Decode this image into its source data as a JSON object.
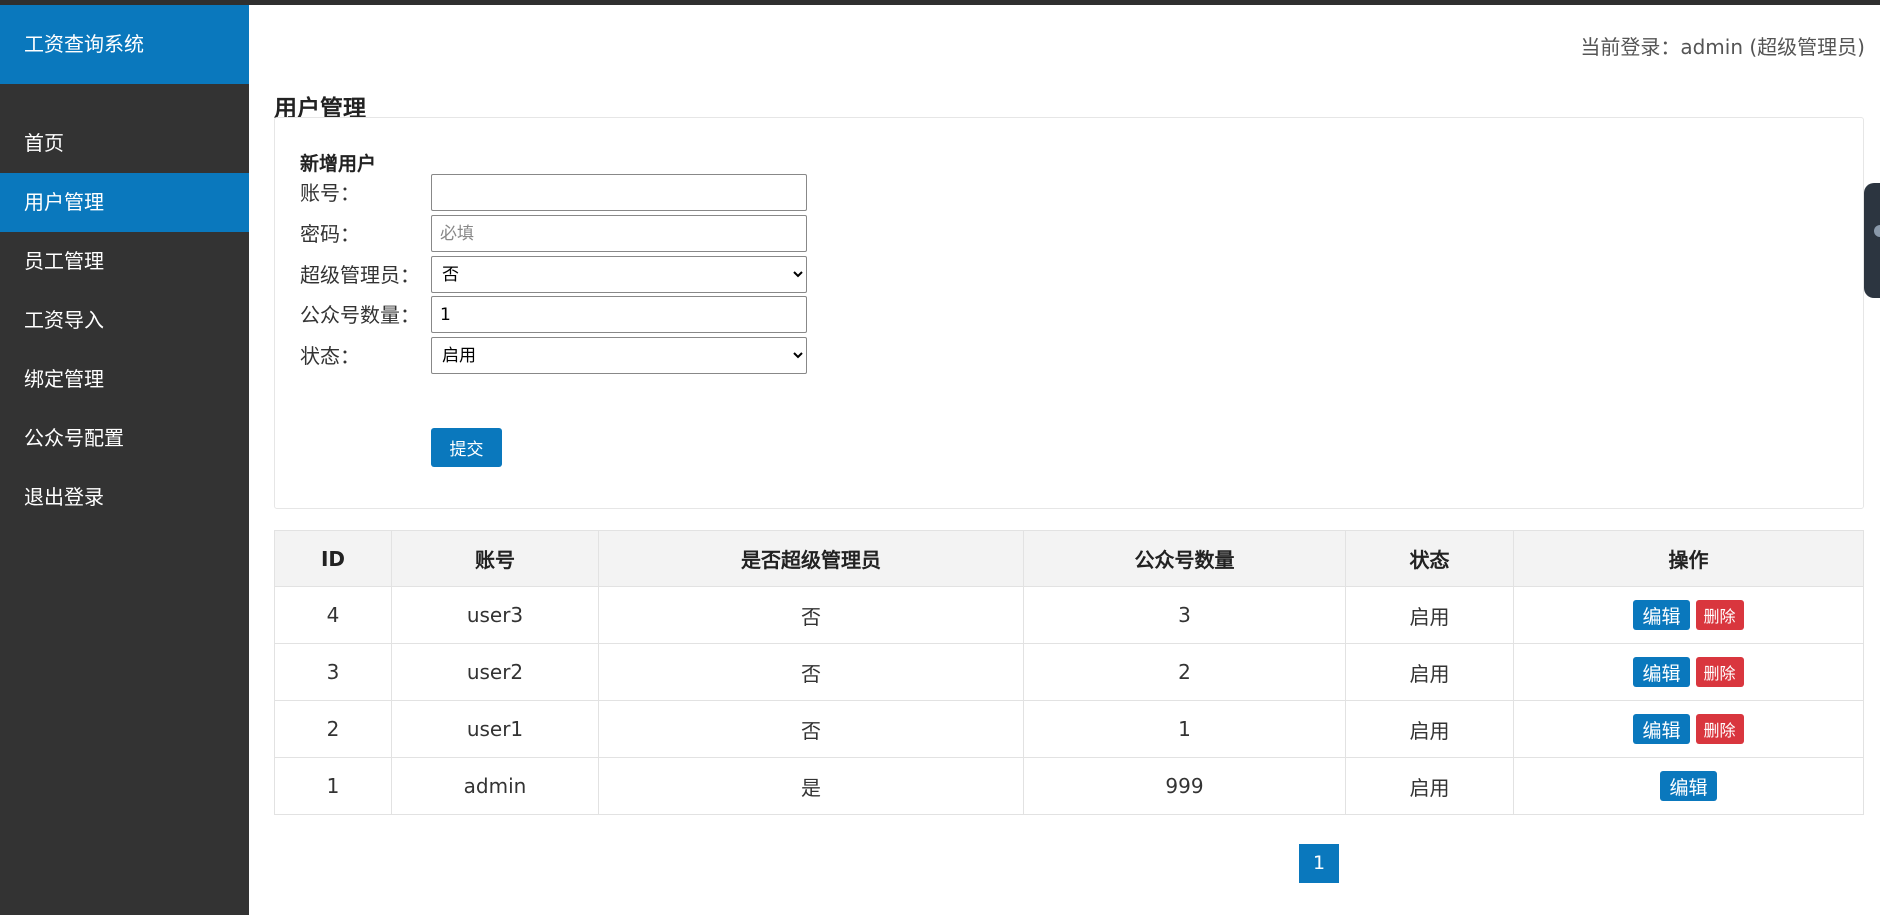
{
  "app": {
    "title": "工资查询系统"
  },
  "sidebar": {
    "items": [
      {
        "label": "首页"
      },
      {
        "label": "用户管理"
      },
      {
        "label": "员工管理"
      },
      {
        "label": "工资导入"
      },
      {
        "label": "绑定管理"
      },
      {
        "label": "公众号配置"
      },
      {
        "label": "退出登录"
      }
    ],
    "active": "用户管理"
  },
  "header": {
    "current_user": "当前登录：admin (超级管理员)"
  },
  "page": {
    "title": "用户管理"
  },
  "form": {
    "title": "新增用户",
    "account_label": "账号：",
    "account_value": "",
    "password_label": "密码：",
    "password_placeholder": "必填",
    "superadmin_label": "超级管理员：",
    "superadmin_value": "否",
    "count_label": "公众号数量：",
    "count_value": "1",
    "status_label": "状态：",
    "status_value": "启用",
    "submit_label": "提交"
  },
  "table": {
    "headers": [
      "ID",
      "账号",
      "是否超级管理员",
      "公众号数量",
      "状态",
      "操作"
    ],
    "rows": [
      {
        "id": "4",
        "account": "user3",
        "is_super": "否",
        "count": "3",
        "status": "启用",
        "edit": "编辑",
        "delete": "删除"
      },
      {
        "id": "3",
        "account": "user2",
        "is_super": "否",
        "count": "2",
        "status": "启用",
        "edit": "编辑",
        "delete": "删除"
      },
      {
        "id": "2",
        "account": "user1",
        "is_super": "否",
        "count": "1",
        "status": "启用",
        "edit": "编辑",
        "delete": "删除"
      },
      {
        "id": "1",
        "account": "admin",
        "is_super": "是",
        "count": "999",
        "status": "启用",
        "edit": "编辑"
      }
    ]
  },
  "pagination": {
    "current": "1"
  },
  "colors": {
    "primary": "#0a78bd",
    "sidebar": "#333333",
    "danger": "#d9363e"
  }
}
